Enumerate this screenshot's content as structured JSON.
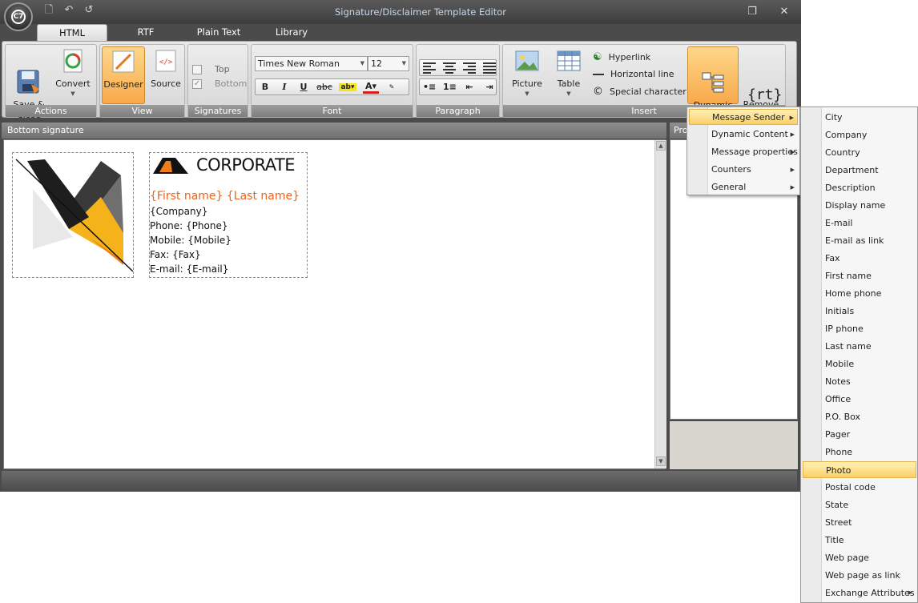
{
  "window": {
    "title": "Signature/Disclaimer Template Editor"
  },
  "tabs": [
    {
      "label": "HTML",
      "active": true
    },
    {
      "label": "RTF",
      "active": false
    },
    {
      "label": "Plain Text",
      "active": false
    },
    {
      "label": "Library",
      "active": false
    }
  ],
  "ribbon": {
    "actions": {
      "label": "Actions",
      "save_close": "Save &\nClose",
      "convert": "Convert"
    },
    "view": {
      "label": "View",
      "designer": "Designer",
      "source": "Source"
    },
    "signatures": {
      "label": "Signatures",
      "top": "Top",
      "bottom": "Bottom"
    },
    "font": {
      "label": "Font",
      "family": "Times New Roman",
      "size": "12"
    },
    "paragraph": {
      "label": "Paragraph"
    },
    "insert": {
      "label": "Insert",
      "picture": "Picture",
      "table": "Table",
      "hyperlink": "Hyperlink",
      "horizontal_line": "Horizontal line",
      "special_character": "Special character",
      "dynamic_field": "Dynamic\nField",
      "remove_text_tag": "Remove\nText Tag",
      "rt_glyph": "{rt}"
    }
  },
  "editor": {
    "header": "Bottom signature",
    "brand": "CORPORATE",
    "name": "{First name} {Last name}",
    "lines": [
      "{Company}",
      "Phone: {Phone}",
      "Mobile: {Mobile}",
      "Fax: {Fax}",
      "E-mail: {E-mail}"
    ]
  },
  "properties": {
    "header": "Pro"
  },
  "menu_dynamic_field": [
    {
      "label": "Message Sender",
      "highlighted": true
    },
    {
      "label": "Dynamic Content",
      "highlighted": false
    },
    {
      "label": "Message properties",
      "highlighted": false
    },
    {
      "label": "Counters",
      "highlighted": false
    },
    {
      "label": "General",
      "highlighted": false
    }
  ],
  "menu_sender_fields": [
    "City",
    "Company",
    "Country",
    "Department",
    "Description",
    "Display name",
    "E-mail",
    "E-mail as link",
    "Fax",
    "First name",
    "Home phone",
    "Initials",
    "IP phone",
    "Last name",
    "Mobile",
    "Notes",
    "Office",
    "P.O. Box",
    "Pager",
    "Phone",
    "Photo",
    "Postal code",
    "State",
    "Street",
    "Title",
    "Web page",
    "Web page as link",
    "Exchange Attributes"
  ],
  "menu_sender_highlighted": "Photo",
  "colors": {
    "accent": "#e8641e",
    "highlight": "#fbd068"
  }
}
